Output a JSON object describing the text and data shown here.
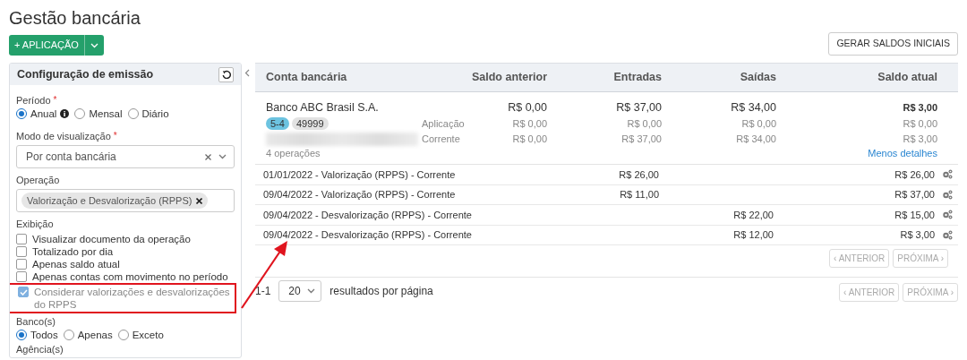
{
  "page": {
    "title": "Gestão bancária"
  },
  "toolbar": {
    "add_button": "+ APLICAÇÃO",
    "initial_button": "GERAR SALDOS INICIAIS"
  },
  "filters": {
    "title": "Configuração de emissão",
    "periodo": {
      "label": "Período",
      "required_mark": "*",
      "options": [
        {
          "label": "Anual",
          "selected": true,
          "info": true
        },
        {
          "label": "Mensal",
          "selected": false,
          "info": false
        },
        {
          "label": "Diário",
          "selected": false,
          "info": false
        }
      ]
    },
    "modo": {
      "label": "Modo de visualização",
      "required_mark": "*",
      "value": "Por conta bancária"
    },
    "operacao": {
      "label": "Operação",
      "tags": [
        "Valorização e Desvalorização (RPPS)"
      ]
    },
    "exibicao": {
      "label": "Exibição",
      "options": [
        {
          "label": "Visualizar documento da operação",
          "checked": false,
          "disabled": false,
          "highlighted": false
        },
        {
          "label": "Totalizado por dia",
          "checked": false,
          "disabled": false,
          "highlighted": false
        },
        {
          "label": "Apenas saldo atual",
          "checked": false,
          "disabled": false,
          "highlighted": false
        },
        {
          "label": "Apenas contas com movimento no período",
          "checked": false,
          "disabled": false,
          "highlighted": false
        },
        {
          "label": "Considerar valorizações e desvalorizações do RPPS",
          "checked": true,
          "disabled": true,
          "highlighted": true
        }
      ]
    },
    "bancos": {
      "label": "Banco(s)",
      "options": [
        {
          "label": "Todos",
          "selected": true
        },
        {
          "label": "Apenas",
          "selected": false
        },
        {
          "label": "Exceto",
          "selected": false
        }
      ]
    },
    "agencias": {
      "label": "Agência(s)"
    }
  },
  "table": {
    "columns": [
      "Conta bancária",
      "Saldo anterior",
      "Entradas",
      "Saídas",
      "Saldo atual"
    ],
    "account": {
      "name": "Banco ABC Brasil S.A.",
      "badges": [
        {
          "text": "5-4",
          "color": "#6cc3e0"
        },
        {
          "text": "49999",
          "color": "#e2e2e2"
        }
      ],
      "totals": [
        "R$ 0,00",
        "R$ 37,00",
        "R$ 34,00",
        "R$ 3,00"
      ],
      "breakdown": [
        {
          "label": "Aplicação",
          "values": [
            "R$ 0,00",
            "R$ 0,00",
            "R$ 0,00",
            "R$ 0,00"
          ]
        },
        {
          "label": "Corrente",
          "values": [
            "R$ 0,00",
            "R$ 37,00",
            "R$ 34,00",
            "R$ 3,00"
          ]
        }
      ],
      "count": "4 operações",
      "toggle_link": "Menos detalhes"
    },
    "operations": [
      {
        "description": "01/01/2022 - Valorização (RPPS) - Corrente",
        "entradas": "R$ 26,00",
        "saldo_atual": "R$ 26,00"
      },
      {
        "description": "09/04/2022 - Valorização (RPPS) - Corrente",
        "entradas": "R$ 11,00",
        "saldo_atual": "R$ 37,00"
      },
      {
        "description": "09/04/2022 - Desvalorização (RPPS) - Corrente",
        "saidas": "R$ 22,00",
        "saldo_atual": "R$ 15,00"
      },
      {
        "description": "09/04/2022 - Desvalorização (RPPS) - Corrente",
        "saidas": "R$ 12,00",
        "saldo_atual": "R$ 3,00"
      }
    ],
    "inner_pagination": {
      "prev": "‹ ANTERIOR",
      "next": "PRÓXIMA ›",
      "disabled": true
    }
  },
  "footer": {
    "range": "1-1",
    "page_size": "20",
    "per_page_label": "resultados por página",
    "pagination": {
      "prev": "‹ ANTERIOR",
      "next": "PRÓXIMA ›",
      "disabled": true
    }
  },
  "annotation": {
    "arrow": true
  }
}
